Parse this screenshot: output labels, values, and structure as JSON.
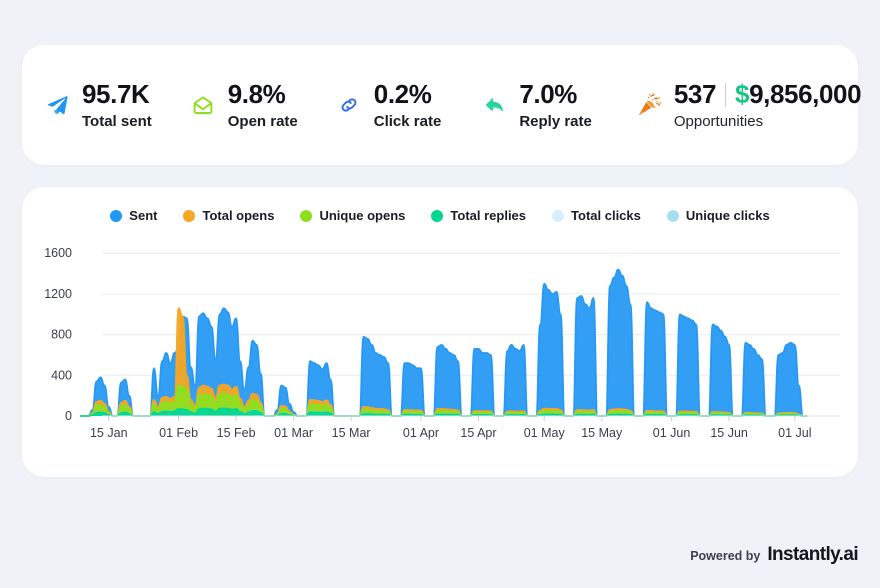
{
  "stats": [
    {
      "icon": "send-icon",
      "value": "95.7K",
      "label": "Total sent"
    },
    {
      "icon": "envelope-open-icon",
      "value": "9.8%",
      "label": "Open rate"
    },
    {
      "icon": "link-icon",
      "value": "0.2%",
      "label": "Click rate"
    },
    {
      "icon": "reply-arrow-icon",
      "value": "7.0%",
      "label": "Reply rate"
    },
    {
      "icon": "party-popper-icon",
      "value": "537",
      "value2": "$9,856,000",
      "label": "Opportunities"
    }
  ],
  "opportunities": {
    "count": "537",
    "amount": "$9,856,000",
    "amount_symbol": "$",
    "amount_number": "9,856,000",
    "label": "Opportunities"
  },
  "footer": {
    "powered_by": "Powered by",
    "brand": "Instantly.ai"
  },
  "colors": {
    "background": "#eff2f7",
    "card": "#ffffff",
    "sent": "#2196f3",
    "total_opens": "#f5a623",
    "unique_opens": "#8ede1f",
    "total_replies": "#00d68f",
    "total_clicks": "#d6f0fa",
    "unique_clicks": "#a8dff0",
    "accent_green": "#16c784",
    "send_blue": "#2196f3",
    "envelope_green": "#8ede1f",
    "link_blue": "#2f6fe4",
    "grid": "#e9ecf1"
  },
  "chart_data": {
    "type": "area",
    "title": "",
    "xlabel": "",
    "ylabel": "",
    "ylim": [
      0,
      1700
    ],
    "yticks": [
      0,
      400,
      800,
      1200,
      1600
    ],
    "grid": true,
    "legend_position": "top-center",
    "xtick_labels": [
      "15 Jan",
      "01 Feb",
      "15 Feb",
      "01 Mar",
      "15 Mar",
      "01 Apr",
      "15 Apr",
      "01 May",
      "15 May",
      "01 Jun",
      "15 Jun",
      "01 Jul"
    ],
    "xtick_indices": [
      7,
      24,
      38,
      52,
      66,
      83,
      97,
      113,
      127,
      144,
      158,
      174
    ],
    "x_count": 186,
    "series": [
      {
        "name": "Sent",
        "color": "#2196f3",
        "values": [
          0,
          0,
          0,
          60,
          340,
          380,
          300,
          90,
          0,
          0,
          330,
          360,
          200,
          0,
          0,
          0,
          0,
          0,
          470,
          200,
          540,
          620,
          520,
          620,
          660,
          980,
          960,
          480,
          300,
          980,
          1010,
          960,
          880,
          560,
          1000,
          1060,
          1020,
          880,
          960,
          540,
          260,
          480,
          740,
          700,
          420,
          0,
          0,
          0,
          60,
          300,
          280,
          120,
          40,
          0,
          0,
          0,
          540,
          520,
          500,
          460,
          520,
          360,
          0,
          0,
          0,
          0,
          0,
          0,
          0,
          780,
          760,
          700,
          620,
          600,
          580,
          520,
          0,
          0,
          0,
          520,
          520,
          500,
          470,
          470,
          0,
          0,
          0,
          680,
          700,
          660,
          620,
          600,
          540,
          0,
          0,
          0,
          660,
          660,
          620,
          620,
          600,
          0,
          0,
          0,
          640,
          700,
          660,
          640,
          700,
          0,
          0,
          0,
          900,
          1300,
          1240,
          1200,
          1220,
          1000,
          0,
          0,
          0,
          1160,
          1180,
          1100,
          1060,
          1160,
          0,
          0,
          0,
          1280,
          1360,
          1440,
          1380,
          1280,
          1100,
          0,
          0,
          0,
          1120,
          1060,
          1040,
          1020,
          1000,
          0,
          0,
          0,
          1000,
          980,
          960,
          940,
          900,
          0,
          0,
          0,
          900,
          880,
          840,
          780,
          700,
          0,
          0,
          0,
          720,
          700,
          660,
          600,
          560,
          0,
          0,
          0,
          600,
          620,
          700,
          720,
          700,
          300,
          0,
          0
        ]
      },
      {
        "name": "Total opens",
        "color": "#f5a623",
        "values": [
          0,
          0,
          0,
          30,
          140,
          150,
          120,
          40,
          0,
          0,
          130,
          150,
          90,
          0,
          0,
          0,
          0,
          0,
          160,
          90,
          180,
          190,
          170,
          190,
          1060,
          980,
          400,
          160,
          100,
          280,
          300,
          290,
          270,
          180,
          300,
          310,
          300,
          260,
          290,
          170,
          90,
          150,
          220,
          210,
          130,
          0,
          0,
          0,
          20,
          100,
          95,
          45,
          15,
          0,
          0,
          0,
          160,
          155,
          150,
          140,
          155,
          110,
          0,
          0,
          0,
          0,
          0,
          0,
          0,
          90,
          88,
          80,
          72,
          70,
          68,
          60,
          0,
          0,
          0,
          60,
          60,
          58,
          55,
          55,
          0,
          0,
          0,
          70,
          72,
          68,
          64,
          62,
          56,
          0,
          0,
          0,
          50,
          50,
          48,
          48,
          46,
          0,
          0,
          0,
          44,
          48,
          45,
          44,
          48,
          0,
          0,
          0,
          55,
          75,
          72,
          70,
          71,
          58,
          0,
          0,
          0,
          60,
          61,
          57,
          55,
          60,
          0,
          0,
          0,
          62,
          66,
          70,
          67,
          62,
          54,
          0,
          0,
          0,
          52,
          50,
          48,
          48,
          46,
          0,
          0,
          0,
          46,
          45,
          44,
          43,
          42,
          0,
          0,
          0,
          40,
          39,
          38,
          36,
          32,
          0,
          0,
          0,
          33,
          32,
          30,
          28,
          26,
          0,
          0,
          0,
          28,
          29,
          32,
          33,
          32,
          14,
          0,
          0
        ]
      },
      {
        "name": "Unique opens",
        "color": "#8ede1f",
        "values": [
          0,
          0,
          0,
          22,
          100,
          110,
          86,
          28,
          0,
          0,
          95,
          110,
          64,
          0,
          0,
          0,
          0,
          0,
          115,
          64,
          130,
          140,
          125,
          140,
          300,
          290,
          260,
          115,
          72,
          200,
          215,
          210,
          195,
          130,
          215,
          222,
          215,
          186,
          208,
          122,
          64,
          108,
          158,
          150,
          93,
          0,
          0,
          0,
          14,
          72,
          68,
          32,
          10,
          0,
          0,
          0,
          115,
          112,
          108,
          100,
          112,
          79,
          0,
          0,
          0,
          0,
          0,
          0,
          0,
          64,
          63,
          57,
          51,
          50,
          48,
          43,
          0,
          0,
          0,
          43,
          43,
          41,
          39,
          39,
          0,
          0,
          0,
          50,
          51,
          48,
          46,
          44,
          40,
          0,
          0,
          0,
          36,
          36,
          34,
          34,
          33,
          0,
          0,
          0,
          31,
          34,
          32,
          31,
          34,
          0,
          0,
          0,
          39,
          54,
          52,
          50,
          51,
          41,
          0,
          0,
          0,
          43,
          44,
          41,
          39,
          43,
          0,
          0,
          0,
          44,
          47,
          50,
          48,
          44,
          39,
          0,
          0,
          0,
          37,
          36,
          34,
          34,
          33,
          0,
          0,
          0,
          33,
          32,
          31,
          31,
          30,
          0,
          0,
          0,
          29,
          28,
          27,
          26,
          23,
          0,
          0,
          0,
          24,
          23,
          21,
          20,
          19,
          0,
          0,
          0,
          20,
          21,
          23,
          24,
          23,
          10,
          0,
          0
        ]
      },
      {
        "name": "Total replies",
        "color": "#00d68f",
        "values": [
          0,
          0,
          0,
          8,
          34,
          38,
          30,
          10,
          0,
          0,
          32,
          38,
          22,
          0,
          0,
          0,
          0,
          0,
          40,
          22,
          45,
          48,
          43,
          48,
          70,
          68,
          60,
          40,
          25,
          68,
          73,
          72,
          66,
          44,
          73,
          76,
          73,
          63,
          71,
          42,
          22,
          37,
          54,
          51,
          32,
          0,
          0,
          0,
          5,
          25,
          23,
          11,
          4,
          0,
          0,
          0,
          39,
          38,
          37,
          34,
          38,
          27,
          0,
          0,
          0,
          0,
          0,
          0,
          0,
          22,
          21,
          19,
          17,
          17,
          16,
          15,
          0,
          0,
          0,
          15,
          15,
          14,
          13,
          13,
          0,
          0,
          0,
          17,
          17,
          16,
          16,
          15,
          14,
          0,
          0,
          0,
          12,
          12,
          12,
          12,
          11,
          0,
          0,
          0,
          11,
          12,
          11,
          11,
          12,
          0,
          0,
          0,
          13,
          18,
          18,
          17,
          17,
          14,
          0,
          0,
          0,
          15,
          15,
          14,
          13,
          15,
          0,
          0,
          0,
          15,
          16,
          17,
          16,
          15,
          13,
          0,
          0,
          0,
          13,
          12,
          12,
          12,
          11,
          0,
          0,
          0,
          11,
          11,
          11,
          11,
          10,
          0,
          0,
          0,
          10,
          10,
          9,
          9,
          8,
          0,
          0,
          0,
          8,
          8,
          7,
          7,
          6,
          0,
          0,
          0,
          7,
          7,
          8,
          8,
          8,
          3,
          0,
          0
        ]
      },
      {
        "name": "Total clicks",
        "color": "#d6f0fa",
        "values": [
          0,
          0,
          0,
          14,
          58,
          62,
          50,
          17,
          0,
          0,
          54,
          62,
          37,
          0,
          0,
          0,
          0,
          0,
          66,
          37,
          74,
          80,
          72,
          80,
          100,
          98,
          90,
          66,
          42,
          95,
          100,
          98,
          92,
          74,
          100,
          104,
          100,
          88,
          98,
          70,
          38,
          62,
          90,
          86,
          54,
          0,
          0,
          0,
          8,
          42,
          39,
          19,
          7,
          0,
          0,
          0,
          66,
          64,
          62,
          57,
          64,
          45,
          0,
          0,
          0,
          0,
          0,
          0,
          0,
          37,
          36,
          32,
          29,
          28,
          27,
          25,
          0,
          0,
          0,
          25,
          25,
          24,
          22,
          22,
          0,
          0,
          0,
          28,
          29,
          27,
          26,
          25,
          23,
          0,
          0,
          0,
          20,
          20,
          20,
          20,
          19,
          0,
          0,
          0,
          18,
          20,
          19,
          18,
          20,
          0,
          0,
          0,
          22,
          30,
          30,
          28,
          29,
          24,
          0,
          0,
          0,
          25,
          25,
          23,
          22,
          25,
          0,
          0,
          0,
          26,
          27,
          29,
          28,
          26,
          22,
          0,
          0,
          0,
          21,
          21,
          20,
          20,
          19,
          0,
          0,
          0,
          19,
          18,
          18,
          18,
          17,
          0,
          0,
          0,
          17,
          16,
          16,
          15,
          13,
          0,
          0,
          0,
          14,
          13,
          12,
          12,
          11,
          0,
          0,
          0,
          12,
          12,
          13,
          14,
          13,
          6,
          0,
          0
        ]
      },
      {
        "name": "Unique clicks",
        "color": "#a8dff0",
        "values": [
          0,
          0,
          0,
          9,
          36,
          39,
          31,
          11,
          0,
          0,
          34,
          39,
          23,
          0,
          0,
          0,
          0,
          0,
          41,
          23,
          46,
          50,
          45,
          50,
          62,
          61,
          56,
          41,
          26,
          59,
          62,
          61,
          57,
          46,
          62,
          65,
          62,
          55,
          61,
          44,
          24,
          39,
          56,
          54,
          34,
          0,
          0,
          0,
          5,
          26,
          24,
          12,
          4,
          0,
          0,
          0,
          41,
          40,
          39,
          36,
          40,
          28,
          0,
          0,
          0,
          0,
          0,
          0,
          0,
          23,
          22,
          20,
          18,
          17,
          17,
          16,
          0,
          0,
          0,
          16,
          16,
          15,
          14,
          14,
          0,
          0,
          0,
          17,
          18,
          17,
          16,
          16,
          14,
          0,
          0,
          0,
          12,
          12,
          12,
          12,
          12,
          0,
          0,
          0,
          11,
          12,
          12,
          11,
          12,
          0,
          0,
          0,
          14,
          19,
          19,
          17,
          18,
          15,
          0,
          0,
          0,
          16,
          16,
          14,
          14,
          16,
          0,
          0,
          0,
          16,
          17,
          18,
          17,
          16,
          14,
          0,
          0,
          0,
          13,
          13,
          12,
          12,
          12,
          0,
          0,
          0,
          12,
          11,
          11,
          11,
          10,
          0,
          0,
          0,
          10,
          10,
          10,
          9,
          8,
          0,
          0,
          0,
          9,
          8,
          8,
          7,
          7,
          0,
          0,
          0,
          7,
          7,
          8,
          9,
          8,
          4,
          0,
          0
        ]
      }
    ]
  }
}
